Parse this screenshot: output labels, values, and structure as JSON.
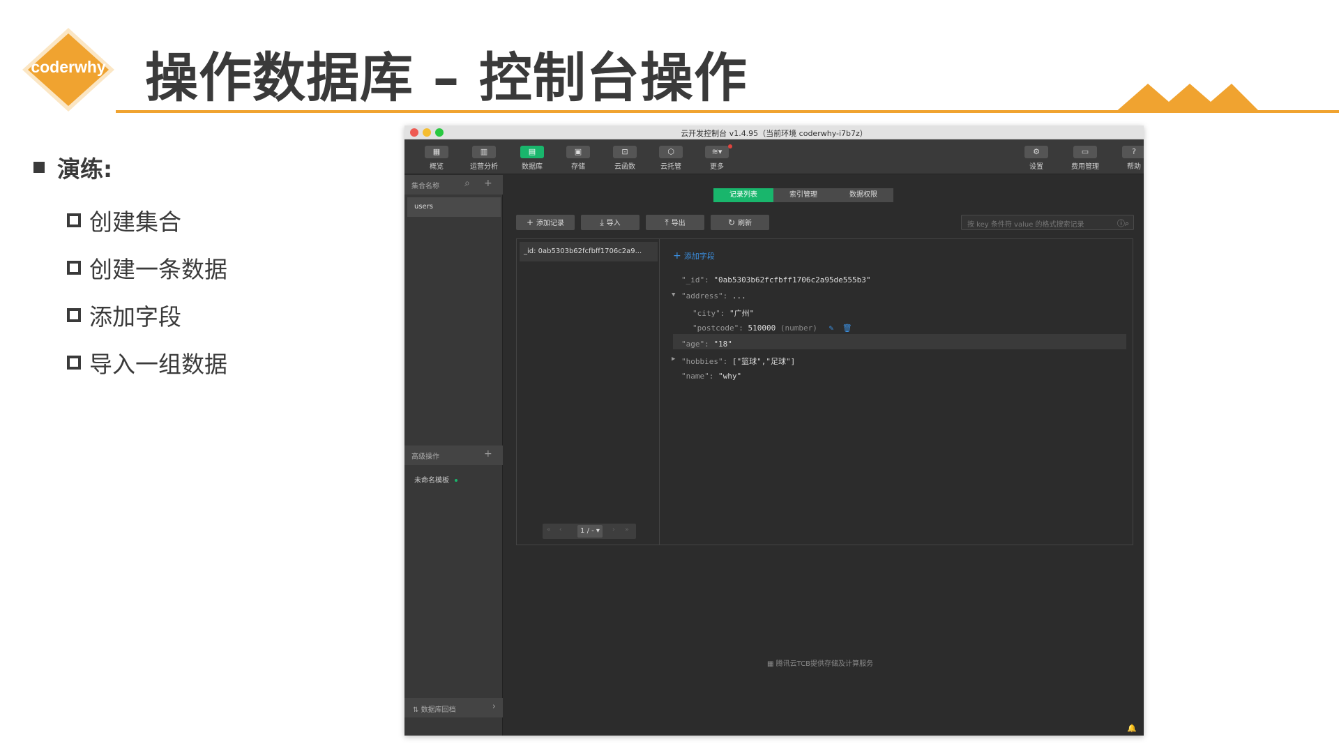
{
  "slide": {
    "logo_text": "coderwhy",
    "title": "操作数据库 – 控制台操作",
    "brand_color": "#f0a330",
    "bullet": "演练:",
    "items": [
      "创建集合",
      "创建一条数据",
      "添加字段",
      "导入一组数据"
    ]
  },
  "window": {
    "title": "云开发控制台 v1.4.95（当前环境 coderwhy-i7b7z）",
    "toolbar": [
      {
        "label": "概览",
        "icon": "grid-icon"
      },
      {
        "label": "运营分析",
        "icon": "bar-chart-icon"
      },
      {
        "label": "数据库",
        "icon": "database-icon",
        "active": true
      },
      {
        "label": "存储",
        "icon": "storage-icon"
      },
      {
        "label": "云函数",
        "icon": "function-icon"
      },
      {
        "label": "云托管",
        "icon": "cube-icon"
      },
      {
        "label": "更多",
        "icon": "layers-icon"
      }
    ],
    "toolbar_right": [
      {
        "label": "设置",
        "icon": "gear-icon"
      },
      {
        "label": "费用管理",
        "icon": "wallet-icon"
      },
      {
        "label": "帮助",
        "icon": "help-icon"
      }
    ],
    "sidebar": {
      "collections_header": "集合名称",
      "collection": "users",
      "advanced_header": "高级操作",
      "template": "未命名模板",
      "footer": "数据库回档"
    },
    "tabs": [
      "记录列表",
      "索引管理",
      "数据权限"
    ],
    "actions": {
      "add_record": "添加记录",
      "import": "导入",
      "export": "导出",
      "refresh": "刷新"
    },
    "search_placeholder": "按 key 条件符 value 的格式搜索记录",
    "record_id": "_id: 0ab5303b62fcfbff1706c2a9...",
    "pager": "1 / -",
    "add_field": "添加字段",
    "fields": {
      "id_key": "\"_id\":",
      "id_val": "\"0ab5303b62fcfbff1706c2a95de555b3\"",
      "address_key": "\"address\":",
      "address_val": "...",
      "city_key": "\"city\":",
      "city_val": "\"广州\"",
      "postcode_key": "\"postcode\":",
      "postcode_val": "510000",
      "postcode_type": "(number)",
      "age_key": "\"age\":",
      "age_val": "\"18\"",
      "hobbies_key": "\"hobbies\":",
      "hobbies_val": "[\"篮球\",\"足球\"]",
      "name_key": "\"name\":",
      "name_val": "\"why\""
    },
    "footer_note": "腾讯云TCB提供存储及计算服务"
  }
}
